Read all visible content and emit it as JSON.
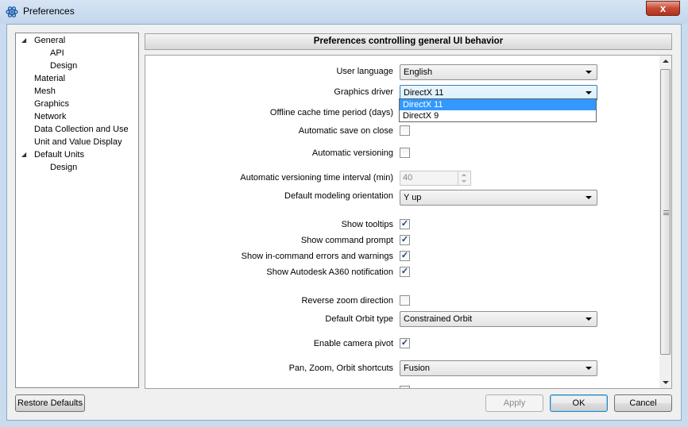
{
  "window": {
    "title": "Preferences",
    "close_glyph": "x"
  },
  "tree": {
    "items": [
      {
        "label": "General",
        "expanded": true
      },
      {
        "label": "API"
      },
      {
        "label": "Design"
      },
      {
        "label": "Material"
      },
      {
        "label": "Mesh"
      },
      {
        "label": "Graphics"
      },
      {
        "label": "Network"
      },
      {
        "label": "Data Collection and Use"
      },
      {
        "label": "Unit and Value Display"
      },
      {
        "label": "Default Units",
        "expanded": true
      },
      {
        "label": "Design"
      }
    ]
  },
  "header": {
    "title": "Preferences controlling general UI behavior"
  },
  "settings": {
    "user_language": {
      "label": "User language",
      "value": "English"
    },
    "graphics_driver": {
      "label": "Graphics driver",
      "value": "DirectX 11",
      "options": [
        "DirectX 11",
        "DirectX 9"
      ]
    },
    "offline_cache": {
      "label": "Offline cache time period (days)"
    },
    "auto_save": {
      "label": "Automatic save on close",
      "checked": false
    },
    "auto_versioning": {
      "label": "Automatic versioning",
      "checked": false
    },
    "versioning_interval": {
      "label": "Automatic versioning time interval (min)",
      "value": "40"
    },
    "modeling_orientation": {
      "label": "Default modeling orientation",
      "value": "Y up"
    },
    "show_tooltips": {
      "label": "Show tooltips",
      "checked": true
    },
    "show_command_prompt": {
      "label": "Show command prompt",
      "checked": true
    },
    "show_errors": {
      "label": "Show in-command errors and warnings",
      "checked": true
    },
    "show_a360": {
      "label": "Show Autodesk A360 notification",
      "checked": true
    },
    "reverse_zoom": {
      "label": "Reverse zoom direction",
      "checked": false
    },
    "orbit_type": {
      "label": "Default Orbit type",
      "value": "Constrained Orbit"
    },
    "camera_pivot": {
      "label": "Enable camera pivot",
      "checked": true
    },
    "shortcuts": {
      "label": "Pan, Zoom, Orbit shortcuts",
      "value": "Fusion"
    }
  },
  "buttons": {
    "restore": "Restore Defaults",
    "apply": "Apply",
    "ok": "OK",
    "cancel": "Cancel"
  },
  "colors": {
    "selection": "#3399ff",
    "close_button": "#c74a35",
    "title_bar": "#c9dcef"
  }
}
